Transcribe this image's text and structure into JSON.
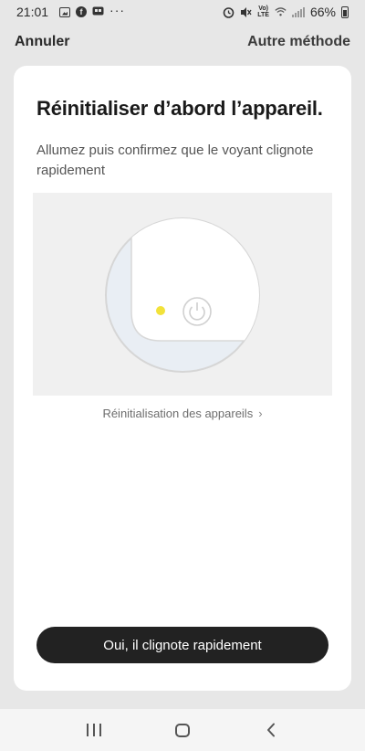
{
  "status_bar": {
    "time": "21:01",
    "more": "···",
    "lte_top": "Vo)",
    "lte_bottom": "LTE",
    "battery": "66%",
    "icons": [
      "gallery-icon",
      "facebook-icon",
      "chat-icon",
      "alarm-icon",
      "mute-icon",
      "wifi-icon",
      "signal-icon",
      "battery-icon"
    ]
  },
  "top_nav": {
    "cancel": "Annuler",
    "other_method": "Autre méthode"
  },
  "card": {
    "title": "Réinitialiser d’abord l’appareil.",
    "subtitle": "Allumez puis confirmez que le voyant clignote rapidement",
    "help_link": "Réinitialisation des appareils",
    "confirm_button": "Oui, il clignote rapidement"
  },
  "colors": {
    "indicator_light": "#f2e23a",
    "button_bg": "#222222",
    "background": "#e7e7e7"
  },
  "navigation_bar": {
    "icons": [
      "recents-icon",
      "home-icon",
      "back-icon"
    ]
  }
}
